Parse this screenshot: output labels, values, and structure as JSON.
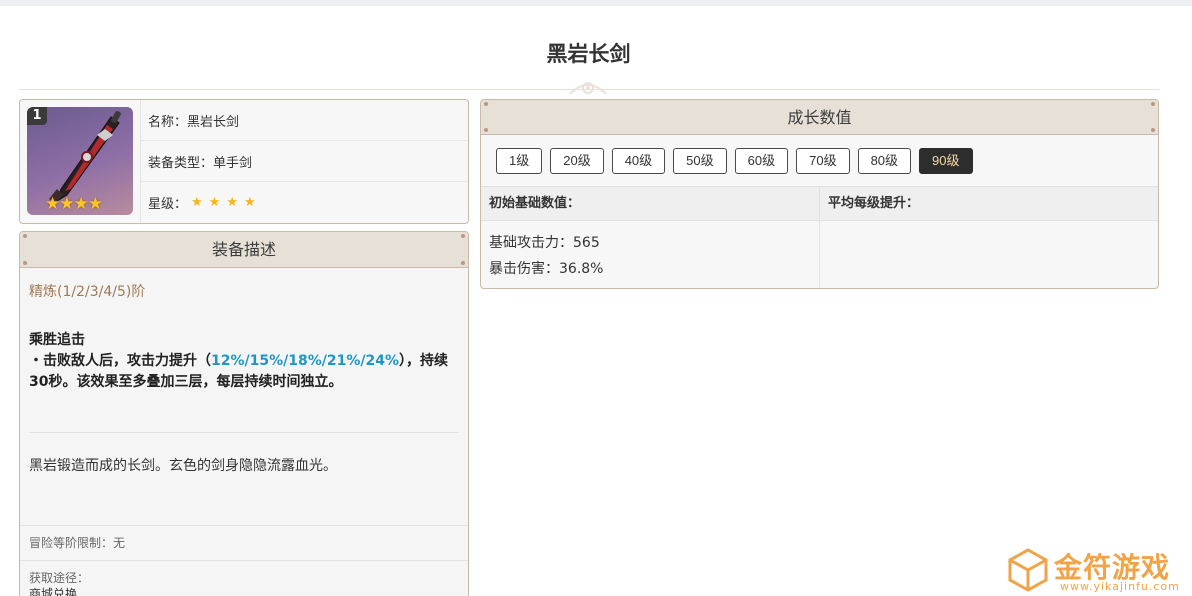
{
  "page": {
    "title": "黑岩长剑"
  },
  "info": {
    "badge": "1",
    "name_label": "名称：",
    "name_value": "黑岩长剑",
    "type_label": "装备类型：",
    "type_value": "单手剑",
    "rarity_label": "星级：",
    "rarity_stars": "★★★★",
    "image_stars": "★★★★",
    "rarity": 4
  },
  "description": {
    "header": "装备描述",
    "refine": "精炼(1/2/3/4/5)阶",
    "skill_name": "乘胜追击",
    "skill_prefix": "・击败敌人后，攻击力提升（",
    "skill_values": "12%/15%/18%/21%/24%",
    "skill_suffix": "），持续30秒。该效果至多叠加三层，每层持续时间独立。",
    "lore": "黑岩锻造而成的长剑。玄色的剑身隐隐流露血光。",
    "rank_limit_label": "冒险等阶限制：",
    "rank_limit_value": "无",
    "source_label": "获取途径：",
    "source_value": "商城兑换"
  },
  "growth": {
    "header": "成长数值",
    "levels": [
      "1级",
      "20级",
      "40级",
      "50级",
      "60级",
      "70级",
      "80级",
      "90级"
    ],
    "active_level": "90级",
    "base_header": "初始基础数值：",
    "avg_header": "平均每级提升：",
    "stats": [
      {
        "label": "基础攻击力：",
        "value": "565"
      },
      {
        "label": "暴击伤害：",
        "value": "36.8%"
      }
    ]
  },
  "watermark": {
    "text": "金符游戏",
    "url": "www.yikajinfu.com"
  },
  "colors": {
    "accent_border": "#c9b9a6",
    "header_bg": "#e6e0d6",
    "highlight": "#1e97c7",
    "refine": "#a07a54",
    "active_btn_bg": "#2d2d2d",
    "active_btn_text": "#f4d9a6",
    "watermark": "#f0a347"
  }
}
